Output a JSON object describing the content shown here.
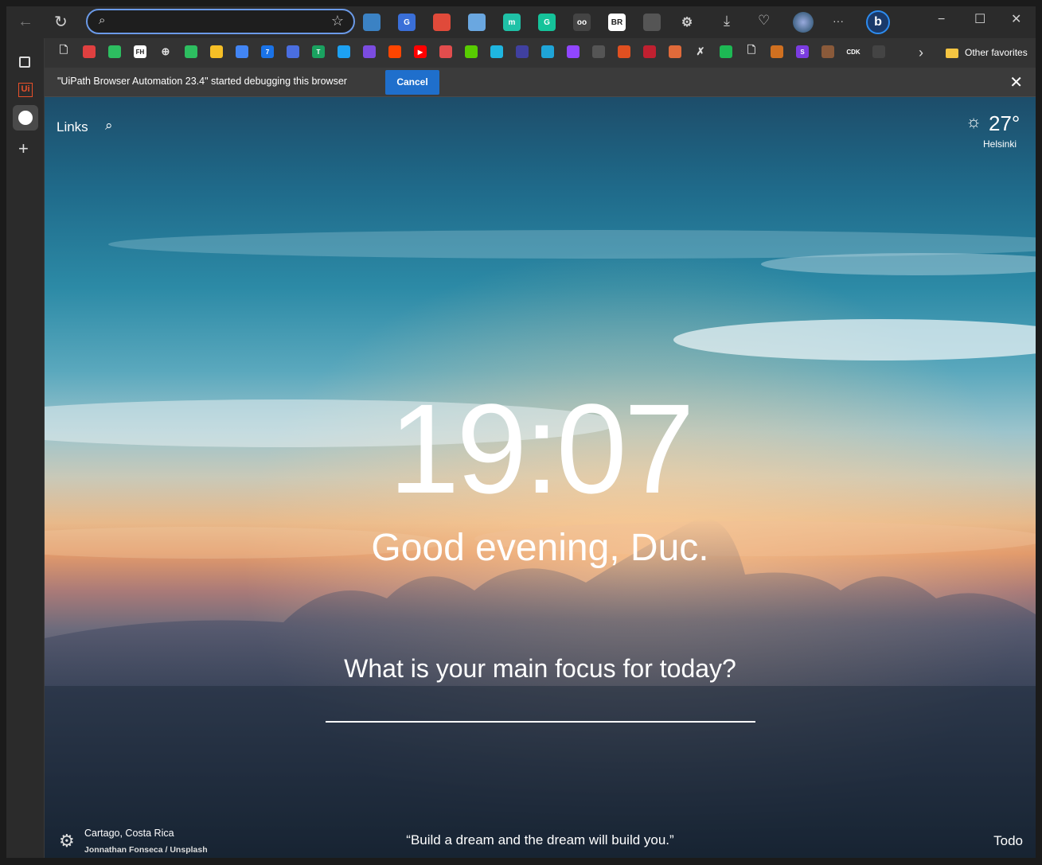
{
  "browser": {
    "window_controls": {
      "minimize": "−",
      "maximize": "☐",
      "close": "✕"
    },
    "address_bar": {
      "value": "",
      "placeholder": ""
    },
    "more_label": "···",
    "bookmarks_overflow": "›",
    "other_favorites_label": "Other favorites",
    "infobar": {
      "message": "\"UiPath Browser Automation 23.4\" started debugging this browser",
      "cancel_label": "Cancel"
    },
    "sidebar": {
      "uipath_label": "Ui"
    }
  },
  "toolbar_extensions": [
    {
      "name": "ext-1",
      "color": "#3b82c4",
      "glyph": ""
    },
    {
      "name": "ext-google-translate",
      "color": "#3a6fd8",
      "glyph": "G"
    },
    {
      "name": "ext-3",
      "color": "#e04a3a",
      "glyph": ""
    },
    {
      "name": "ext-4",
      "color": "#6aa7e0",
      "glyph": ""
    },
    {
      "name": "ext-m",
      "color": "#1fc1a7",
      "glyph": "m"
    },
    {
      "name": "ext-grammarly",
      "color": "#15c39a",
      "glyph": "G"
    },
    {
      "name": "ext-7",
      "color": "#444",
      "glyph": "oo"
    },
    {
      "name": "ext-br",
      "color": "#fff",
      "glyph": "BR"
    },
    {
      "name": "ext-9",
      "color": "#555",
      "glyph": ""
    },
    {
      "name": "ext-extensions",
      "color": "transparent",
      "glyph": "⚙"
    }
  ],
  "bookmarks": [
    {
      "name": "bookmark-page",
      "color": "transparent",
      "glyph": "🗋"
    },
    {
      "name": "bookmark-2",
      "color": "#e04040",
      "glyph": ""
    },
    {
      "name": "bookmark-evernote",
      "color": "#2dbe60",
      "glyph": ""
    },
    {
      "name": "bookmark-fh",
      "color": "#fff",
      "glyph": "FH"
    },
    {
      "name": "bookmark-5",
      "color": "transparent",
      "glyph": "⊕"
    },
    {
      "name": "bookmark-evernote-2",
      "color": "#2dbe60",
      "glyph": ""
    },
    {
      "name": "bookmark-keep",
      "color": "#f6bf26",
      "glyph": ""
    },
    {
      "name": "bookmark-docs",
      "color": "#4285f4",
      "glyph": ""
    },
    {
      "name": "bookmark-calendar",
      "color": "#1a73e8",
      "glyph": "7"
    },
    {
      "name": "bookmark-nyt",
      "color": "#4a6ee0",
      "glyph": ""
    },
    {
      "name": "bookmark-11",
      "color": "#1aa260",
      "glyph": "T"
    },
    {
      "name": "bookmark-twitter",
      "color": "#1da1f2",
      "glyph": ""
    },
    {
      "name": "bookmark-messenger",
      "color": "#7b4ce0",
      "glyph": ""
    },
    {
      "name": "bookmark-reddit",
      "color": "#ff4500",
      "glyph": ""
    },
    {
      "name": "bookmark-youtube",
      "color": "#ff0000",
      "glyph": "▶"
    },
    {
      "name": "bookmark-16",
      "color": "#e24d4d",
      "glyph": ""
    },
    {
      "name": "bookmark-duolingo",
      "color": "#58cc02",
      "glyph": ""
    },
    {
      "name": "bookmark-18",
      "color": "#1fb6e0",
      "glyph": ""
    },
    {
      "name": "bookmark-19",
      "color": "#4040a0",
      "glyph": ""
    },
    {
      "name": "bookmark-20",
      "color": "#1fa5d8",
      "glyph": ""
    },
    {
      "name": "bookmark-twitch",
      "color": "#9146ff",
      "glyph": ""
    },
    {
      "name": "bookmark-22",
      "color": "#555",
      "glyph": ""
    },
    {
      "name": "bookmark-23",
      "color": "#e05020",
      "glyph": ""
    },
    {
      "name": "bookmark-24",
      "color": "#c02030",
      "glyph": ""
    },
    {
      "name": "bookmark-25",
      "color": "#e06a3a",
      "glyph": ""
    },
    {
      "name": "bookmark-26",
      "color": "transparent",
      "glyph": "✗"
    },
    {
      "name": "bookmark-spotify",
      "color": "#1db954",
      "glyph": ""
    },
    {
      "name": "bookmark-page-2",
      "color": "transparent",
      "glyph": "🗋"
    },
    {
      "name": "bookmark-29",
      "color": "#d07020",
      "glyph": ""
    },
    {
      "name": "bookmark-s",
      "color": "#7b3ce0",
      "glyph": "S"
    },
    {
      "name": "bookmark-31",
      "color": "#8a5a3a",
      "glyph": ""
    },
    {
      "name": "bookmark-cdk",
      "color": "#333",
      "glyph": "CDK"
    },
    {
      "name": "bookmark-33",
      "color": "#444",
      "glyph": ""
    }
  ],
  "momentum": {
    "links_label": "Links",
    "weather": {
      "temperature": "27°",
      "city": "Helsinki"
    },
    "clock": "19:07",
    "greeting": "Good evening, Duc.",
    "focus_prompt": "What is your main focus for today?",
    "focus_input_value": "",
    "photo_location": "Cartago, Costa Rica",
    "photo_credit": "Jonnathan Fonseca / Unsplash",
    "quote": "“Build a dream and the dream will build you.”",
    "todo_label": "Todo"
  }
}
